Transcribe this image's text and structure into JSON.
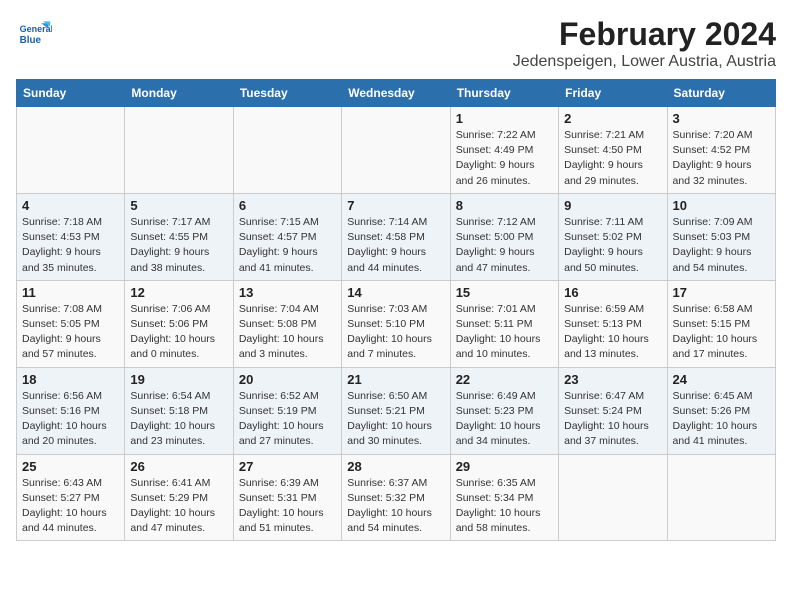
{
  "header": {
    "logo_line1": "General",
    "logo_line2": "Blue",
    "title": "February 2024",
    "subtitle": "Jedenspeigen, Lower Austria, Austria"
  },
  "days_of_week": [
    "Sunday",
    "Monday",
    "Tuesday",
    "Wednesday",
    "Thursday",
    "Friday",
    "Saturday"
  ],
  "weeks": [
    [
      {
        "day": "",
        "info": ""
      },
      {
        "day": "",
        "info": ""
      },
      {
        "day": "",
        "info": ""
      },
      {
        "day": "",
        "info": ""
      },
      {
        "day": "1",
        "info": "Sunrise: 7:22 AM\nSunset: 4:49 PM\nDaylight: 9 hours and 26 minutes."
      },
      {
        "day": "2",
        "info": "Sunrise: 7:21 AM\nSunset: 4:50 PM\nDaylight: 9 hours and 29 minutes."
      },
      {
        "day": "3",
        "info": "Sunrise: 7:20 AM\nSunset: 4:52 PM\nDaylight: 9 hours and 32 minutes."
      }
    ],
    [
      {
        "day": "4",
        "info": "Sunrise: 7:18 AM\nSunset: 4:53 PM\nDaylight: 9 hours and 35 minutes."
      },
      {
        "day": "5",
        "info": "Sunrise: 7:17 AM\nSunset: 4:55 PM\nDaylight: 9 hours and 38 minutes."
      },
      {
        "day": "6",
        "info": "Sunrise: 7:15 AM\nSunset: 4:57 PM\nDaylight: 9 hours and 41 minutes."
      },
      {
        "day": "7",
        "info": "Sunrise: 7:14 AM\nSunset: 4:58 PM\nDaylight: 9 hours and 44 minutes."
      },
      {
        "day": "8",
        "info": "Sunrise: 7:12 AM\nSunset: 5:00 PM\nDaylight: 9 hours and 47 minutes."
      },
      {
        "day": "9",
        "info": "Sunrise: 7:11 AM\nSunset: 5:02 PM\nDaylight: 9 hours and 50 minutes."
      },
      {
        "day": "10",
        "info": "Sunrise: 7:09 AM\nSunset: 5:03 PM\nDaylight: 9 hours and 54 minutes."
      }
    ],
    [
      {
        "day": "11",
        "info": "Sunrise: 7:08 AM\nSunset: 5:05 PM\nDaylight: 9 hours and 57 minutes."
      },
      {
        "day": "12",
        "info": "Sunrise: 7:06 AM\nSunset: 5:06 PM\nDaylight: 10 hours and 0 minutes."
      },
      {
        "day": "13",
        "info": "Sunrise: 7:04 AM\nSunset: 5:08 PM\nDaylight: 10 hours and 3 minutes."
      },
      {
        "day": "14",
        "info": "Sunrise: 7:03 AM\nSunset: 5:10 PM\nDaylight: 10 hours and 7 minutes."
      },
      {
        "day": "15",
        "info": "Sunrise: 7:01 AM\nSunset: 5:11 PM\nDaylight: 10 hours and 10 minutes."
      },
      {
        "day": "16",
        "info": "Sunrise: 6:59 AM\nSunset: 5:13 PM\nDaylight: 10 hours and 13 minutes."
      },
      {
        "day": "17",
        "info": "Sunrise: 6:58 AM\nSunset: 5:15 PM\nDaylight: 10 hours and 17 minutes."
      }
    ],
    [
      {
        "day": "18",
        "info": "Sunrise: 6:56 AM\nSunset: 5:16 PM\nDaylight: 10 hours and 20 minutes."
      },
      {
        "day": "19",
        "info": "Sunrise: 6:54 AM\nSunset: 5:18 PM\nDaylight: 10 hours and 23 minutes."
      },
      {
        "day": "20",
        "info": "Sunrise: 6:52 AM\nSunset: 5:19 PM\nDaylight: 10 hours and 27 minutes."
      },
      {
        "day": "21",
        "info": "Sunrise: 6:50 AM\nSunset: 5:21 PM\nDaylight: 10 hours and 30 minutes."
      },
      {
        "day": "22",
        "info": "Sunrise: 6:49 AM\nSunset: 5:23 PM\nDaylight: 10 hours and 34 minutes."
      },
      {
        "day": "23",
        "info": "Sunrise: 6:47 AM\nSunset: 5:24 PM\nDaylight: 10 hours and 37 minutes."
      },
      {
        "day": "24",
        "info": "Sunrise: 6:45 AM\nSunset: 5:26 PM\nDaylight: 10 hours and 41 minutes."
      }
    ],
    [
      {
        "day": "25",
        "info": "Sunrise: 6:43 AM\nSunset: 5:27 PM\nDaylight: 10 hours and 44 minutes."
      },
      {
        "day": "26",
        "info": "Sunrise: 6:41 AM\nSunset: 5:29 PM\nDaylight: 10 hours and 47 minutes."
      },
      {
        "day": "27",
        "info": "Sunrise: 6:39 AM\nSunset: 5:31 PM\nDaylight: 10 hours and 51 minutes."
      },
      {
        "day": "28",
        "info": "Sunrise: 6:37 AM\nSunset: 5:32 PM\nDaylight: 10 hours and 54 minutes."
      },
      {
        "day": "29",
        "info": "Sunrise: 6:35 AM\nSunset: 5:34 PM\nDaylight: 10 hours and 58 minutes."
      },
      {
        "day": "",
        "info": ""
      },
      {
        "day": "",
        "info": ""
      }
    ]
  ]
}
